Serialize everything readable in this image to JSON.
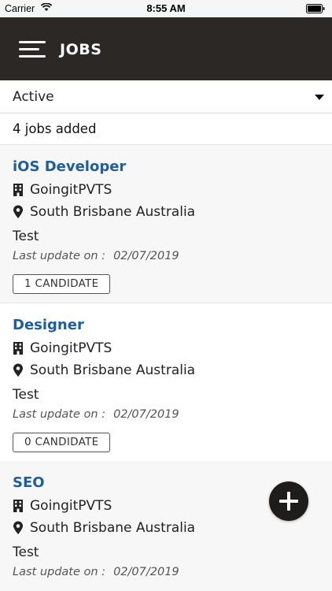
{
  "status_bar": {
    "carrier": "Carrier",
    "time": "8:55 AM",
    "wifi_icon": "wifi-icon",
    "battery_icon": "battery-icon"
  },
  "header": {
    "title": "JOBS",
    "menu_icon": "hamburger-menu-icon",
    "background": "#2b2826"
  },
  "filter": {
    "selected": "Active",
    "icon": "caret-down-icon"
  },
  "summary": {
    "count_text": "4 jobs added"
  },
  "colors": {
    "job_title": "#1e5f9b",
    "fab": "#1f1d1c"
  },
  "jobs": [
    {
      "title": "iOS Developer",
      "company": "GoingitPVTS",
      "location": "South Brisbane Australia",
      "description": "Test",
      "updated_label": "Last update on :",
      "updated_date": "02/07/2019",
      "candidates": "1 CANDIDATE"
    },
    {
      "title": "Designer",
      "company": "GoingitPVTS",
      "location": "South Brisbane Australia",
      "description": "Test",
      "updated_label": "Last update on :",
      "updated_date": "02/07/2019",
      "candidates": "0 CANDIDATE"
    },
    {
      "title": "SEO",
      "company": "GoingitPVTS",
      "location": "South Brisbane Australia",
      "description": "Test",
      "updated_label": "Last update on :",
      "updated_date": "02/07/2019",
      "candidates": ""
    }
  ],
  "fab": {
    "icon": "plus-icon"
  }
}
